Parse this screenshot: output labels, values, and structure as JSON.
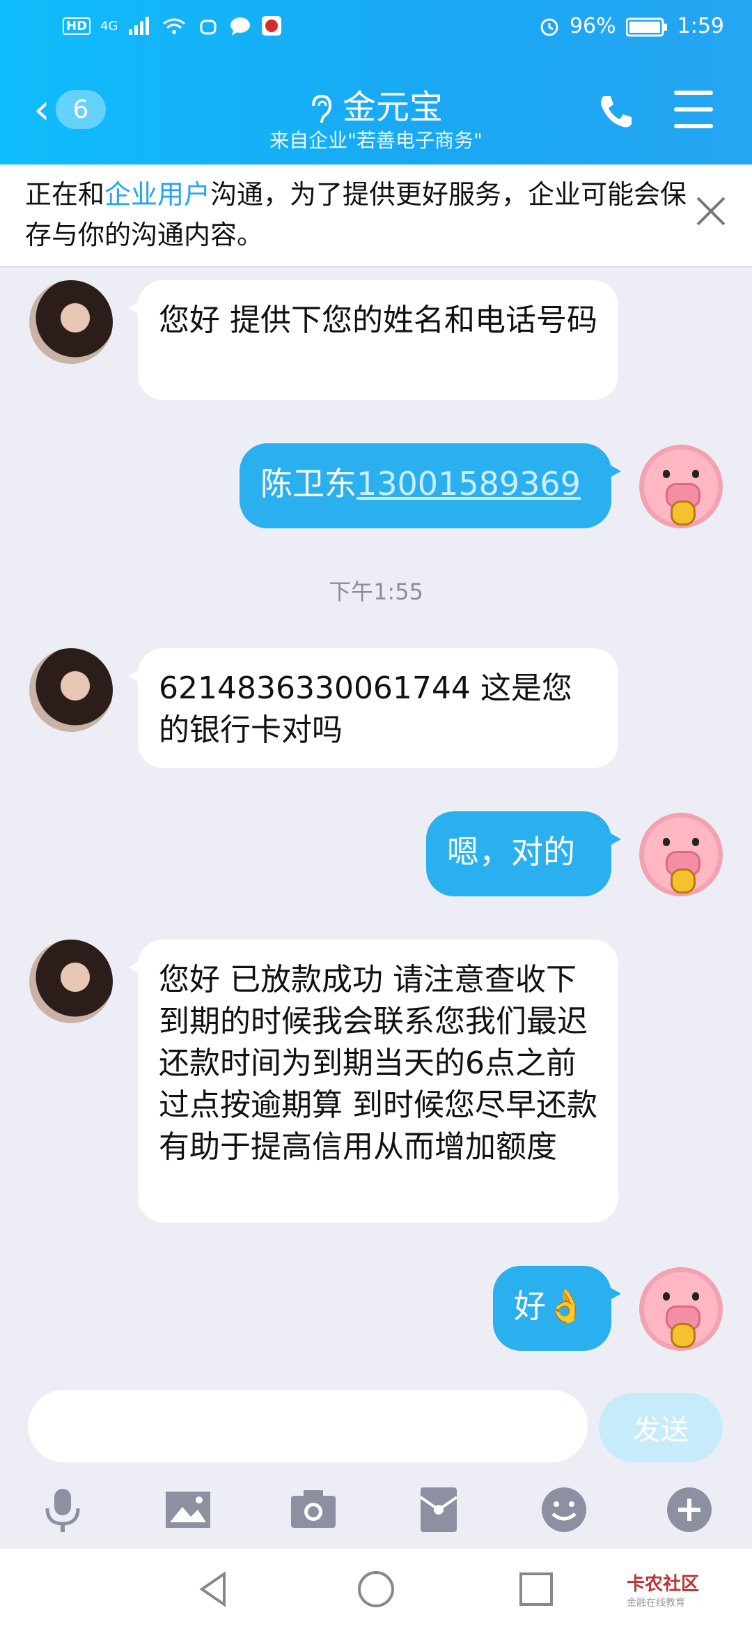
{
  "status": {
    "signal": "4G",
    "battery": "96%",
    "time": "1:59",
    "hd": "HD"
  },
  "header": {
    "back_count": "6",
    "title": "金元宝",
    "subtitle": "来自企业\"若善电子商务\""
  },
  "notice": {
    "before": "正在和",
    "highlight": "企业用户",
    "after": "沟通，为了提供更好服务，企业可能会保存与你的沟通内容。"
  },
  "messages": [
    {
      "side": "left",
      "text": "您好 提供下您的姓名和电话号码"
    },
    {
      "side": "right",
      "name": "陈卫东",
      "phone": "13001589369"
    },
    {
      "side": "left",
      "text": "6214836330061744 这是您的银行卡对吗"
    },
    {
      "side": "right",
      "text": "嗯，对的"
    },
    {
      "side": "left",
      "text": "您好 已放款成功 请注意查收下 到期的时候我会联系您我们最迟还款时间为到期当天的6点之前过点按逾期算 到时候您尽早还款 有助于提高信用从而增加额度"
    },
    {
      "side": "right",
      "text": "好👌"
    }
  ],
  "timestamp": "下午1:55",
  "composer": {
    "placeholder": "",
    "send_label": "发送"
  },
  "watermark": {
    "title": "卡农社区",
    "sub": "金融在线教育"
  },
  "colors": {
    "accent": "#1aa7f3",
    "bubble_right": "#2bb0ef",
    "highlight": "#22a5f0"
  }
}
